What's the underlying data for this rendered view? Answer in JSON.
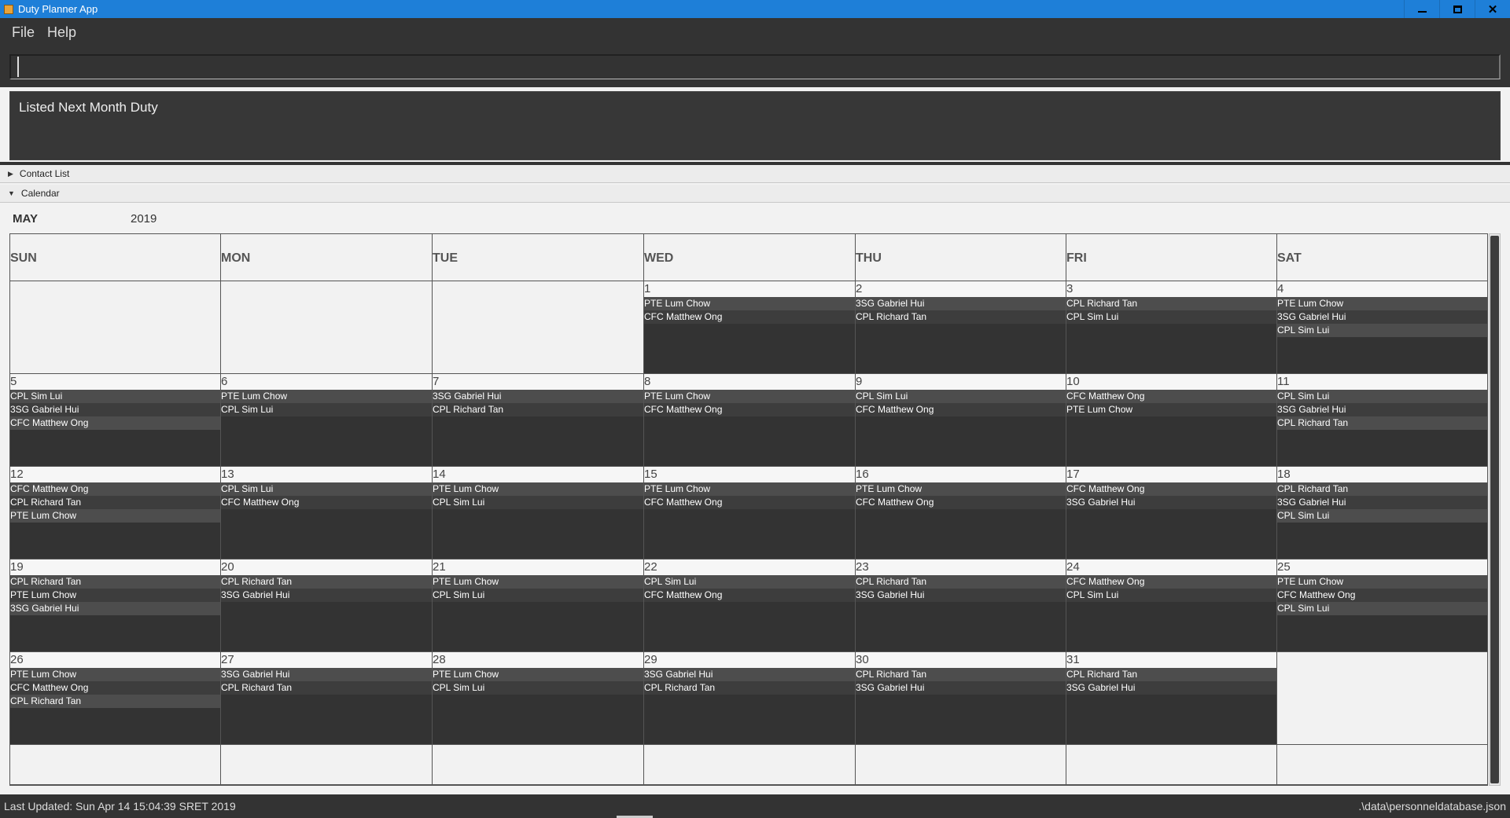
{
  "window": {
    "title": "Duty Planner App"
  },
  "menu": {
    "file": "File",
    "help": "Help"
  },
  "command": {
    "value": ""
  },
  "result": {
    "text": "Listed Next Month Duty"
  },
  "panes": {
    "contacts": "Contact List",
    "calendar": "Calendar"
  },
  "calendar": {
    "month": "MAY",
    "year": "2019",
    "weekdays": [
      "SUN",
      "MON",
      "TUE",
      "WED",
      "THU",
      "FRI",
      "SAT"
    ],
    "start_weekday_index": 3,
    "days": [
      {
        "day": "1",
        "duties": [
          "PTE Lum Chow",
          "CFC Matthew Ong"
        ]
      },
      {
        "day": "2",
        "duties": [
          "3SG Gabriel Hui",
          "CPL Richard Tan"
        ]
      },
      {
        "day": "3",
        "duties": [
          "CPL Richard Tan",
          "CPL Sim Lui"
        ]
      },
      {
        "day": "4",
        "duties": [
          "PTE Lum Chow",
          "3SG Gabriel Hui",
          "CPL Sim Lui"
        ]
      },
      {
        "day": "5",
        "duties": [
          "CPL Sim Lui",
          "3SG Gabriel Hui",
          "CFC Matthew Ong"
        ]
      },
      {
        "day": "6",
        "duties": [
          "PTE Lum Chow",
          "CPL Sim Lui"
        ]
      },
      {
        "day": "7",
        "duties": [
          "3SG Gabriel Hui",
          "CPL Richard Tan"
        ]
      },
      {
        "day": "8",
        "duties": [
          "PTE Lum Chow",
          "CFC Matthew Ong"
        ]
      },
      {
        "day": "9",
        "duties": [
          "CPL Sim Lui",
          "CFC Matthew Ong"
        ]
      },
      {
        "day": "10",
        "duties": [
          "CFC Matthew Ong",
          "PTE Lum Chow"
        ]
      },
      {
        "day": "11",
        "duties": [
          "CPL Sim Lui",
          "3SG Gabriel Hui",
          "CPL Richard Tan"
        ]
      },
      {
        "day": "12",
        "duties": [
          "CFC Matthew Ong",
          "CPL Richard Tan",
          "PTE Lum Chow"
        ]
      },
      {
        "day": "13",
        "duties": [
          "CPL Sim Lui",
          "CFC Matthew Ong"
        ]
      },
      {
        "day": "14",
        "duties": [
          "PTE Lum Chow",
          "CPL Sim Lui"
        ]
      },
      {
        "day": "15",
        "duties": [
          "PTE Lum Chow",
          "CFC Matthew Ong"
        ]
      },
      {
        "day": "16",
        "duties": [
          "PTE Lum Chow",
          "CFC Matthew Ong"
        ]
      },
      {
        "day": "17",
        "duties": [
          "CFC Matthew Ong",
          "3SG Gabriel Hui"
        ]
      },
      {
        "day": "18",
        "duties": [
          "CPL Richard Tan",
          "3SG Gabriel Hui",
          "CPL Sim Lui"
        ]
      },
      {
        "day": "19",
        "duties": [
          "CPL Richard Tan",
          "PTE Lum Chow",
          "3SG Gabriel Hui"
        ]
      },
      {
        "day": "20",
        "duties": [
          "CPL Richard Tan",
          "3SG Gabriel Hui"
        ]
      },
      {
        "day": "21",
        "duties": [
          "PTE Lum Chow",
          "CPL Sim Lui"
        ]
      },
      {
        "day": "22",
        "duties": [
          "CPL Sim Lui",
          "CFC Matthew Ong"
        ]
      },
      {
        "day": "23",
        "duties": [
          "CPL Richard Tan",
          "3SG Gabriel Hui"
        ]
      },
      {
        "day": "24",
        "duties": [
          "CFC Matthew Ong",
          "CPL Sim Lui"
        ]
      },
      {
        "day": "25",
        "duties": [
          "PTE Lum Chow",
          "CFC Matthew Ong",
          "CPL Sim Lui"
        ]
      },
      {
        "day": "26",
        "duties": [
          "PTE Lum Chow",
          "CFC Matthew Ong",
          "CPL Richard Tan"
        ]
      },
      {
        "day": "27",
        "duties": [
          "3SG Gabriel Hui",
          "CPL Richard Tan"
        ]
      },
      {
        "day": "28",
        "duties": [
          "PTE Lum Chow",
          "CPL Sim Lui"
        ]
      },
      {
        "day": "29",
        "duties": [
          "3SG Gabriel Hui",
          "CPL Richard Tan"
        ]
      },
      {
        "day": "30",
        "duties": [
          "CPL Richard Tan",
          "3SG Gabriel Hui"
        ]
      },
      {
        "day": "31",
        "duties": [
          "CPL Richard Tan",
          "3SG Gabriel Hui"
        ]
      }
    ]
  },
  "status": {
    "last_updated": "Last Updated: Sun Apr 14 15:04:39 SRET 2019",
    "file_path": ".\\data\\personneldatabase.json"
  },
  "colors": {
    "titlebar": "#1e7fd8",
    "dark_bg": "#333333",
    "light_bg": "#f2f2f2"
  }
}
